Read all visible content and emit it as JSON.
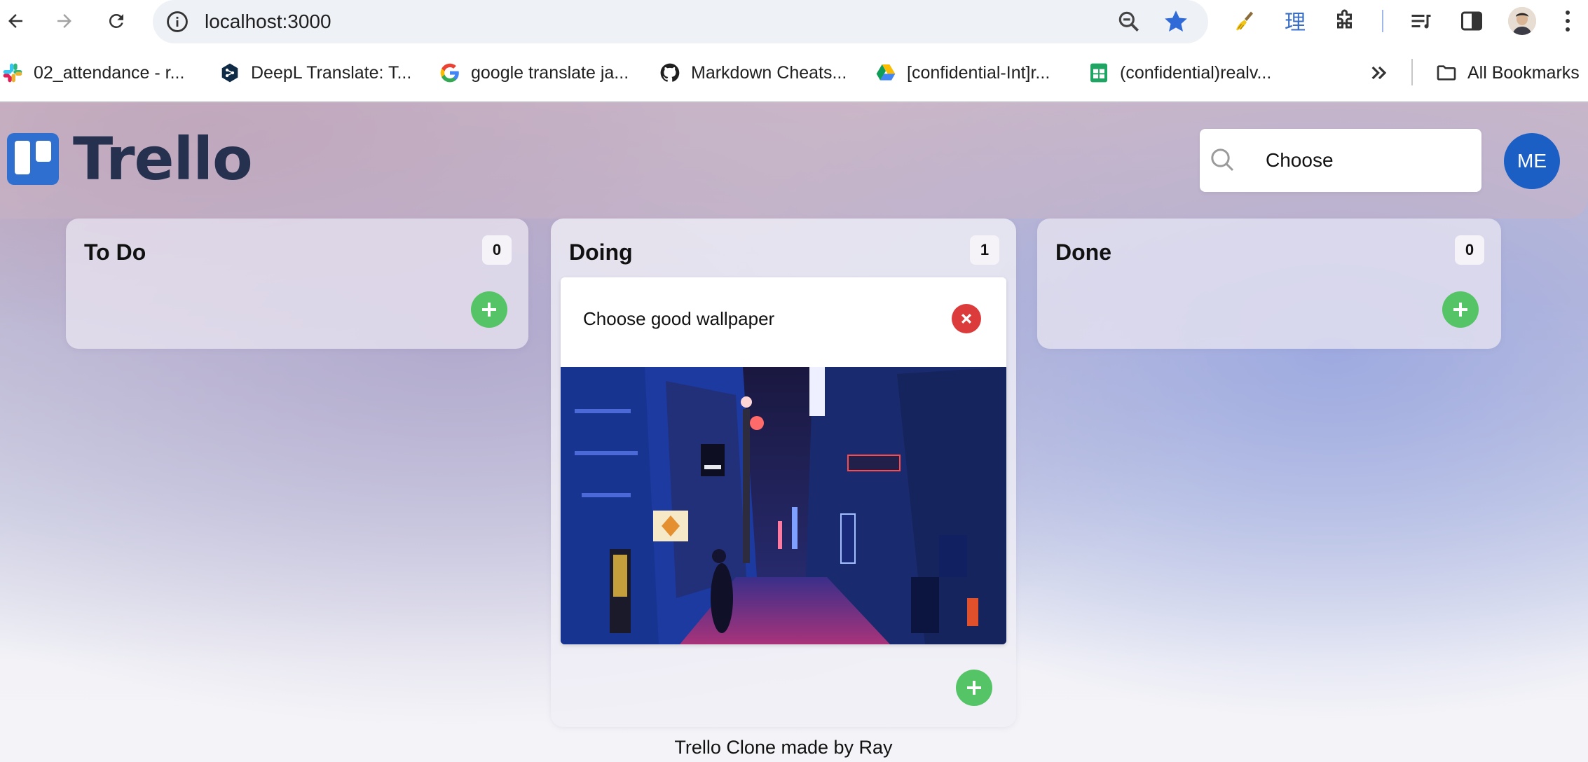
{
  "browser": {
    "url": "localhost:3000",
    "bookmarks": [
      {
        "label": "02_attendance - r...",
        "icon": "slack-icon"
      },
      {
        "label": "DeepL Translate: T...",
        "icon": "deepl-icon"
      },
      {
        "label": "google translate ja...",
        "icon": "google-icon"
      },
      {
        "label": "Markdown Cheats...",
        "icon": "github-icon"
      },
      {
        "label": "[confidential-Int]r...",
        "icon": "google-drive-icon"
      },
      {
        "label": "(confidential)realv...",
        "icon": "google-sheets-icon"
      }
    ],
    "all_bookmarks_label": "All Bookmarks"
  },
  "app": {
    "logo_text": "Trello",
    "search": {
      "value": "Choose"
    },
    "avatar_initials": "ME",
    "columns": [
      {
        "title": "To Do",
        "count": "0",
        "cards": []
      },
      {
        "title": "Doing",
        "count": "1",
        "cards": [
          {
            "title": "Choose good wallpaper",
            "has_image": true
          }
        ]
      },
      {
        "title": "Done",
        "count": "0",
        "cards": []
      }
    ],
    "footer": "Trello Clone made by Ray"
  },
  "colors": {
    "accent_blue": "#2e6fcf",
    "add_green": "#55c466",
    "delete_red": "#dc3b3b",
    "avatar_blue": "#1b5fc4"
  }
}
